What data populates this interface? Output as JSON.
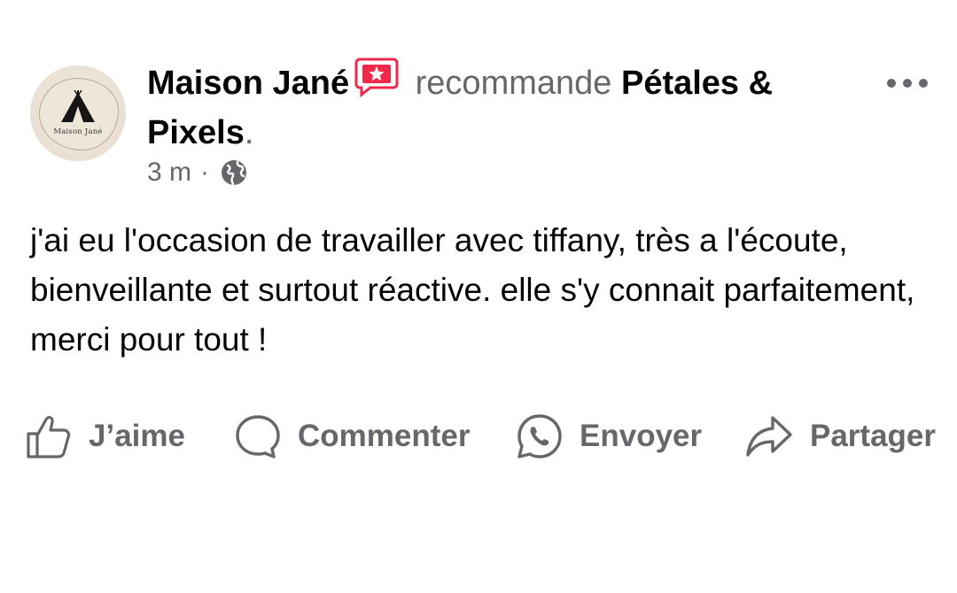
{
  "post": {
    "author": "Maison Jané",
    "action_text": "recommande",
    "page_name": "Pétales & Pixels",
    "page_period": ".",
    "avatar_logo_text": "Maison Jané",
    "time": "3 m",
    "separator": "·",
    "privacy_icon": "globe-icon",
    "body": "j'ai eu l'occasion de travailler avec tiffany, très a l'écoute, bienveillante et surtout réactive. elle s'y connait parfaitement, merci pour tout !"
  },
  "actions": {
    "like_label": "J’aime",
    "comment_label": "Commenter",
    "send_label": "Envoyer",
    "share_label": "Partager"
  },
  "colors": {
    "text_primary": "#050505",
    "text_secondary": "#65676b",
    "recommend_badge": "#f02849",
    "background": "#ffffff"
  }
}
